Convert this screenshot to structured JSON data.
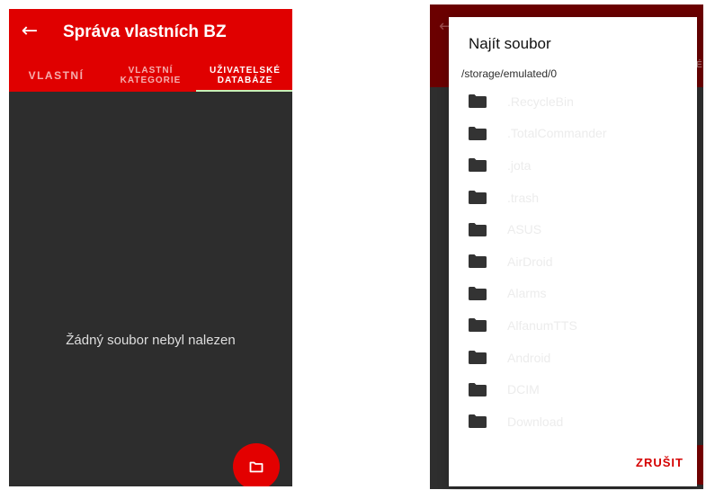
{
  "left_screen": {
    "title": "Správa vlastních BZ",
    "back_icon": "back-arrow-icon",
    "tabs": [
      {
        "label": "VLASTNÍ",
        "active": false
      },
      {
        "label": "VLASTNÍ\nKATEGORIE",
        "active": false
      },
      {
        "label": "UŽIVATELSKÉ\nDATABÁZE",
        "active": true
      }
    ],
    "empty_message": "Žádný soubor nebyl nalezen",
    "fab_icon": "folder-icon",
    "colors": {
      "appbar": "#e00000",
      "background": "#2d2d2d",
      "indicator": "#c7efb6"
    }
  },
  "dialog": {
    "title": "Najít soubor",
    "path": "/storage/emulated/0",
    "items": [
      {
        "name": ".RecycleBin",
        "icon": "folder-icon"
      },
      {
        "name": ".TotalCommander",
        "icon": "folder-icon"
      },
      {
        "name": ".jota",
        "icon": "folder-icon"
      },
      {
        "name": ".trash",
        "icon": "folder-icon"
      },
      {
        "name": "ASUS",
        "icon": "folder-icon"
      },
      {
        "name": "AirDroid",
        "icon": "folder-icon"
      },
      {
        "name": "Alarms",
        "icon": "folder-icon"
      },
      {
        "name": "AlfanumTTS",
        "icon": "folder-icon"
      },
      {
        "name": "Android",
        "icon": "folder-icon"
      },
      {
        "name": "DCIM",
        "icon": "folder-icon"
      },
      {
        "name": "Download",
        "icon": "folder-icon"
      }
    ],
    "cancel_label": "ZRUŠIT",
    "colors": {
      "accent": "#d50000"
    }
  },
  "right_screen": {
    "tab_fragment": "É"
  }
}
